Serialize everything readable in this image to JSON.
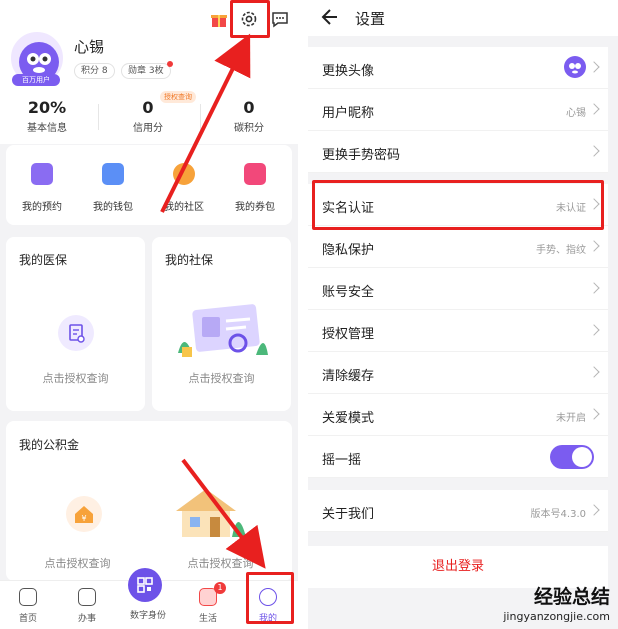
{
  "left": {
    "profile": {
      "username": "心锡",
      "avatar_tag": "百万用户",
      "pills": [
        "积分 8",
        "勋章 3枚"
      ],
      "icons": [
        "gift-icon",
        "gear-icon",
        "message-icon"
      ]
    },
    "stats": [
      {
        "value": "20%",
        "label": "基本信息"
      },
      {
        "value": "0",
        "label": "信用分"
      },
      {
        "value": "0",
        "label": "碳积分"
      }
    ],
    "auth_badge": "授权查询",
    "quick": [
      {
        "label": "我的预约",
        "icon": "calendar-icon",
        "color": "#8a6cf2"
      },
      {
        "label": "我的钱包",
        "icon": "wallet-icon",
        "color": "#5b8ff6"
      },
      {
        "label": "我的社区",
        "icon": "community-icon",
        "color": "#f7a23a"
      },
      {
        "label": "我的券包",
        "icon": "coupon-icon",
        "color": "#f2487a"
      }
    ],
    "cards": {
      "yibao": {
        "title": "我的医保",
        "action": "点击授权查询"
      },
      "shebao": {
        "title": "我的社保",
        "action": "点击授权查询"
      },
      "gongjijin": {
        "title": "我的公积金",
        "action_left": "点击授权查询",
        "action_right": "点击授权查询"
      }
    },
    "tabbar": {
      "tabs": [
        "首页",
        "办事",
        "数字身份",
        "生活",
        "我的"
      ],
      "badge": "1"
    }
  },
  "right": {
    "title": "设置",
    "rows": [
      {
        "label": "更换头像",
        "value": ""
      },
      {
        "label": "用户昵称",
        "value": "心锡"
      },
      {
        "label": "更换手势密码",
        "value": ""
      },
      {
        "label": "实名认证",
        "value": "未认证"
      },
      {
        "label": "隐私保护",
        "value": "手势、指纹"
      },
      {
        "label": "账号安全",
        "value": ""
      },
      {
        "label": "授权管理",
        "value": ""
      },
      {
        "label": "清除缓存",
        "value": ""
      },
      {
        "label": "关爱模式",
        "value": "未开启"
      },
      {
        "label": "摇一摇",
        "value": ""
      },
      {
        "label": "关于我们",
        "value": "版本号4.3.0"
      }
    ],
    "logout": "退出登录",
    "accent": "#7b5cf0"
  },
  "watermark": {
    "big": "经验总结",
    "small": "jingyanzongjie.com"
  }
}
